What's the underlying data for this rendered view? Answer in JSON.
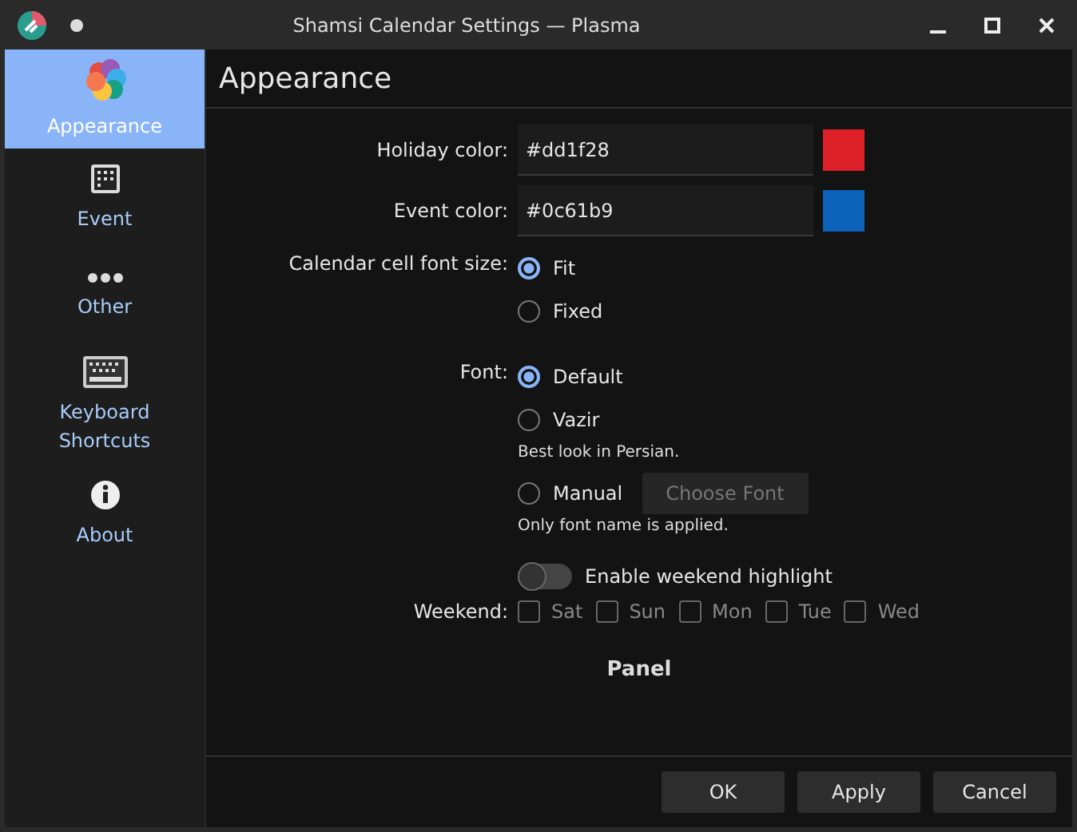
{
  "window": {
    "title": "Shamsi Calendar Settings — Plasma"
  },
  "sidebar": {
    "items": [
      {
        "label": "Appearance",
        "kind": "flower",
        "selected": true
      },
      {
        "label": "Event",
        "kind": "calendar",
        "selected": false
      },
      {
        "label": "Other",
        "kind": "dots",
        "selected": false
      },
      {
        "label": "Keyboard Shortcuts",
        "kind": "keyboard",
        "selected": false
      },
      {
        "label": "About",
        "kind": "info",
        "selected": false
      }
    ]
  },
  "page_title": "Appearance",
  "color_fields": [
    {
      "label": "Holiday color:",
      "value": "#dd1f28",
      "color": "#dd1f28"
    },
    {
      "label": "Event color:",
      "value": "#0c61b9",
      "color": "#0c61b9"
    }
  ],
  "cell_font_size": {
    "label": "Calendar cell font size:",
    "options": [
      {
        "label": "Fit",
        "selected": true
      },
      {
        "label": "Fixed",
        "selected": false
      }
    ]
  },
  "font": {
    "label": "Font:",
    "options": [
      {
        "label": "Default",
        "selected": true
      },
      {
        "label": "Vazir",
        "selected": false,
        "note": "Best look in Persian."
      },
      {
        "label": "Manual",
        "selected": false,
        "button": "Choose Font",
        "note": "Only font name is applied."
      }
    ]
  },
  "weekend_highlight": {
    "label": "Enable weekend highlight",
    "on": false
  },
  "weekend": {
    "label": "Weekend:",
    "days": [
      {
        "label": "Sat",
        "checked": false
      },
      {
        "label": "Sun",
        "checked": false
      },
      {
        "label": "Mon",
        "checked": false
      },
      {
        "label": "Tue",
        "checked": false
      },
      {
        "label": "Wed",
        "checked": false
      }
    ]
  },
  "next_section": "Panel",
  "buttons": [
    "OK",
    "Apply",
    "Cancel"
  ]
}
